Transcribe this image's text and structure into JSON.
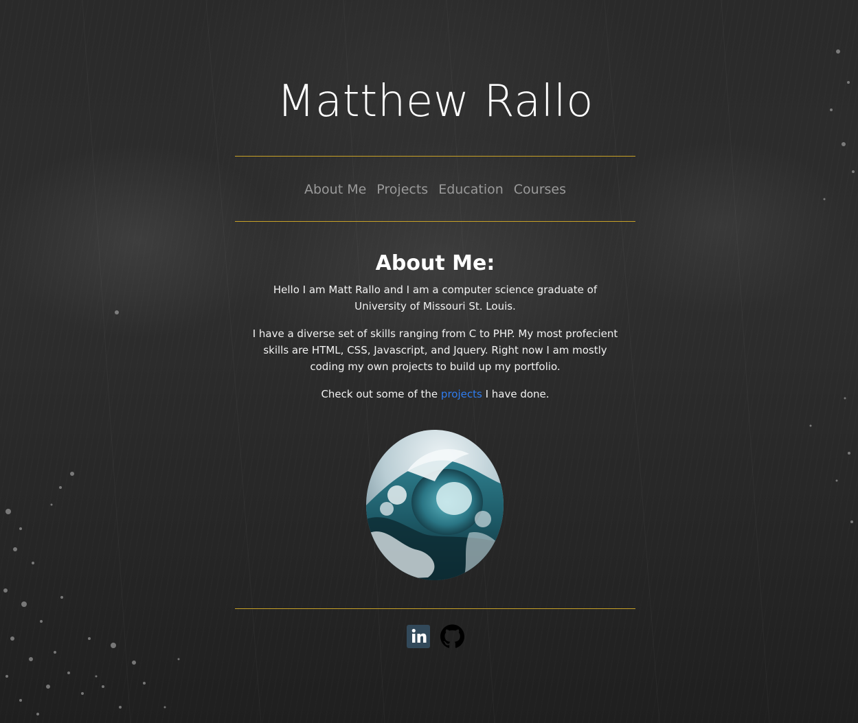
{
  "header": {
    "title": "Matthew Rallo"
  },
  "nav": {
    "items": [
      {
        "label": "About Me"
      },
      {
        "label": "Projects"
      },
      {
        "label": "Education"
      },
      {
        "label": "Courses"
      }
    ]
  },
  "about": {
    "heading": "About Me:",
    "paragraph1": "Hello I am Matt Rallo and I am a computer science graduate of University of Missouri St. Louis.",
    "paragraph2": "I have a diverse set of skills ranging from C to PHP. My most profecient skills are HTML, CSS, Javascript, and Jquery. Right now I am mostly coding my own projects to build up my portfolio.",
    "paragraph3_before": "Check out some of the ",
    "paragraph3_link": "projects",
    "paragraph3_after": " I have done."
  },
  "profile_image": {
    "icon": "ocean-wave-photo"
  },
  "footer": {
    "social": [
      {
        "icon": "linkedin-icon"
      },
      {
        "icon": "github-icon"
      }
    ]
  },
  "colors": {
    "accent_rule": "#c9a227",
    "link": "#2f7df0",
    "nav_text": "#9a9a9a",
    "background": "#2a2a2a"
  }
}
